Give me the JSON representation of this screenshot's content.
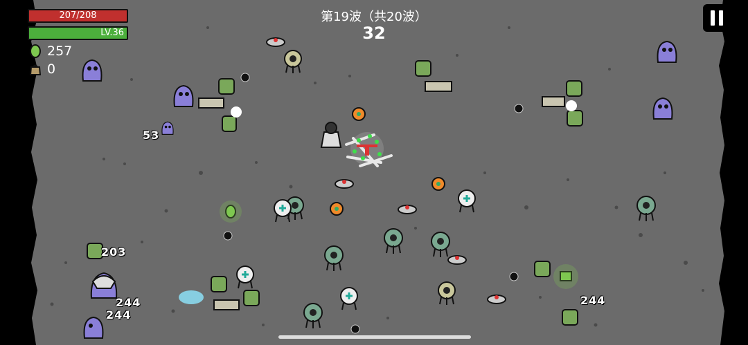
{
  "hud": {
    "hp_text": "207/208",
    "hp_fraction": 0.995,
    "level_text": "LV.36",
    "xp_fraction": 1.0,
    "materials_count": "257",
    "bag_count": "0",
    "wave_title": "第19波（共20波）",
    "wave_timer": "32"
  },
  "colors": {
    "ground": "#6b6b6b",
    "hp": "#c0302e",
    "xp": "#4caf3c",
    "material": "#7ec850",
    "enemy_purple": "#8a7fd8"
  },
  "icons": {
    "materials": "green-leaf-icon",
    "bag": "bag-icon",
    "pause": "pause-icon"
  },
  "damage_numbers": [
    "53",
    "203",
    "244",
    "244",
    "244"
  ]
}
